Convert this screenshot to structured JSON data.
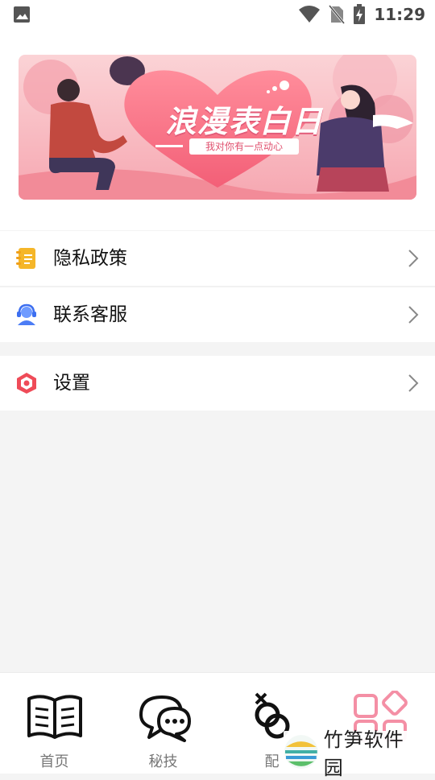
{
  "status_bar": {
    "time": "11:29",
    "icons": [
      "gallery-icon",
      "wifi-icon",
      "no-sim-icon",
      "battery-charging-icon"
    ]
  },
  "banner": {
    "title": "浪漫表白日",
    "subtitle": "我对你有一点动心"
  },
  "menu": {
    "items": [
      {
        "label": "隐私政策",
        "icon": "notebook-icon",
        "color": "#f5b629"
      },
      {
        "label": "联系客服",
        "icon": "customer-service-icon",
        "color": "#4c7df5"
      },
      {
        "label": "设置",
        "icon": "settings-hexagon-icon",
        "color": "#ef4b58"
      }
    ]
  },
  "tabbar": {
    "tabs": [
      {
        "label": "首页",
        "icon": "open-book-icon"
      },
      {
        "label": "秘技",
        "icon": "chat-bubbles-icon"
      },
      {
        "label": "配",
        "icon": "linked-rings-icon"
      },
      {
        "label": "",
        "icon": "grid-shapes-icon",
        "color": "#f48fa5"
      }
    ]
  },
  "watermark": {
    "text": "竹笋软件园"
  }
}
